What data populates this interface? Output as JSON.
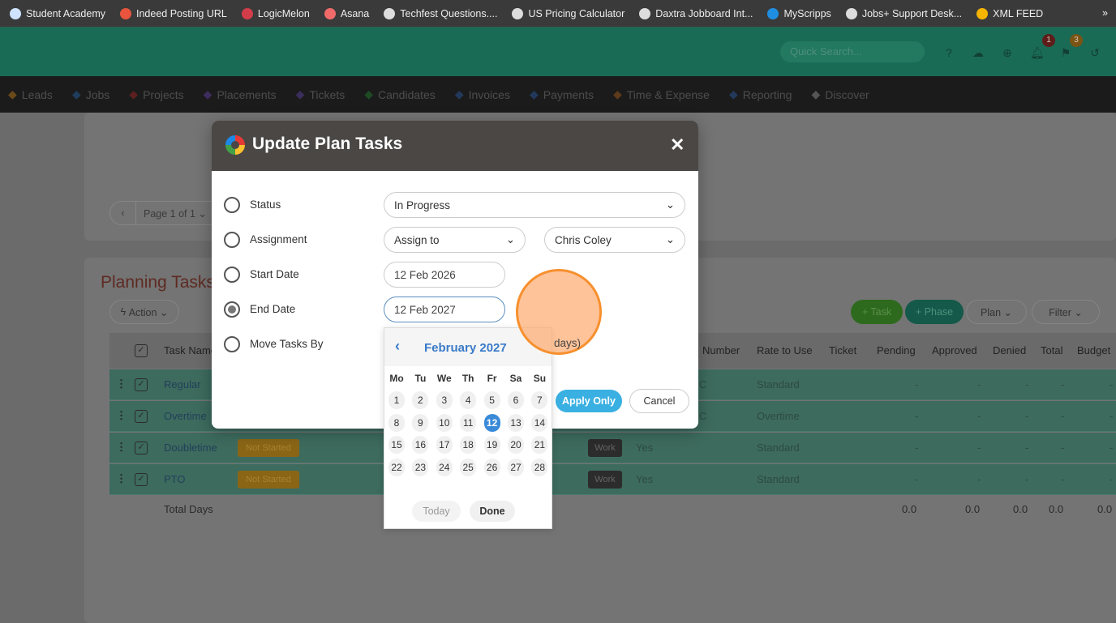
{
  "bookmarks": [
    "Student Academy",
    "Indeed Posting URL",
    "LogicMelon",
    "Asana",
    "Techfest Questions....",
    "US Pricing Calculator",
    "Daxtra Jobboard Int...",
    "MyScripps",
    "Jobs+ Support Desk...",
    "XML FEED"
  ],
  "bookmarks_more": "»",
  "header": {
    "search_placeholder": "Quick Search...",
    "notif_count": "1",
    "flag_count": "3"
  },
  "nav": [
    "Leads",
    "Jobs",
    "Projects",
    "Placements",
    "Tickets",
    "Candidates",
    "Invoices",
    "Payments",
    "Time & Expense",
    "Reporting",
    "Discover"
  ],
  "pager": {
    "prev": "‹",
    "label": "Page 1 of 1 ⌄"
  },
  "planning": {
    "title": "Planning Tasks",
    "action": "Action ⌄",
    "task_btn": "+ Task",
    "phase_btn": "+ Phase",
    "plan_btn": "Plan ⌄",
    "filter_btn": "Filter ⌄"
  },
  "table": {
    "headers": {
      "task_name": "Task Name",
      "number": "Number",
      "rate": "Rate to Use",
      "ticket": "Ticket",
      "pending": "Pending",
      "approved": "Approved",
      "denied": "Denied",
      "total": "Total",
      "budget": "Budget"
    },
    "rows": [
      {
        "name": "Regular",
        "status": "",
        "type": "",
        "billable": "",
        "number_suffix": "C",
        "rate": "Standard",
        "pending": "-",
        "approved": "-",
        "denied": "-",
        "total": "-",
        "budget": "-"
      },
      {
        "name": "Overtime",
        "status": "",
        "type": "",
        "billable": "",
        "number_suffix": "C",
        "rate": "Overtime",
        "pending": "-",
        "approved": "-",
        "denied": "-",
        "total": "-",
        "budget": "-"
      },
      {
        "name": "Doubletime",
        "status": "Not Started",
        "type": "Work",
        "billable": "Yes",
        "number_suffix": "",
        "rate": "Standard",
        "pending": "-",
        "approved": "-",
        "denied": "-",
        "total": "-",
        "budget": "-"
      },
      {
        "name": "PTO",
        "status": "Not Started",
        "type": "Work",
        "billable": "Yes",
        "number_suffix": "",
        "rate": "Standard",
        "pending": "-",
        "approved": "-",
        "denied": "-",
        "total": "-",
        "budget": "-"
      }
    ],
    "total_label": "Total Days",
    "totals": {
      "pending": "0.0",
      "approved": "0.0",
      "denied": "0.0",
      "total": "0.0",
      "budget": "0.0"
    }
  },
  "modal": {
    "title": "Update Plan Tasks",
    "close": "✕",
    "options": [
      {
        "label": "Status",
        "selected": false
      },
      {
        "label": "Assignment",
        "selected": false
      },
      {
        "label": "Start Date",
        "selected": false
      },
      {
        "label": "End Date",
        "selected": true
      },
      {
        "label": "Move Tasks By",
        "selected": false
      }
    ],
    "status_value": "In Progress",
    "assign_mode": "Assign to",
    "assignee": "Chris Coley",
    "start_date": "12 Feb 2026",
    "end_date": "12 Feb 2027",
    "move_suffix": "days)",
    "apply_only": "Apply Only",
    "cancel": "Cancel"
  },
  "calendar": {
    "month": "February 2027",
    "prev": "‹",
    "dow": [
      "Mo",
      "Tu",
      "We",
      "Th",
      "Fr",
      "Sa",
      "Su"
    ],
    "selected_day": 12,
    "today": "Today",
    "done": "Done"
  }
}
